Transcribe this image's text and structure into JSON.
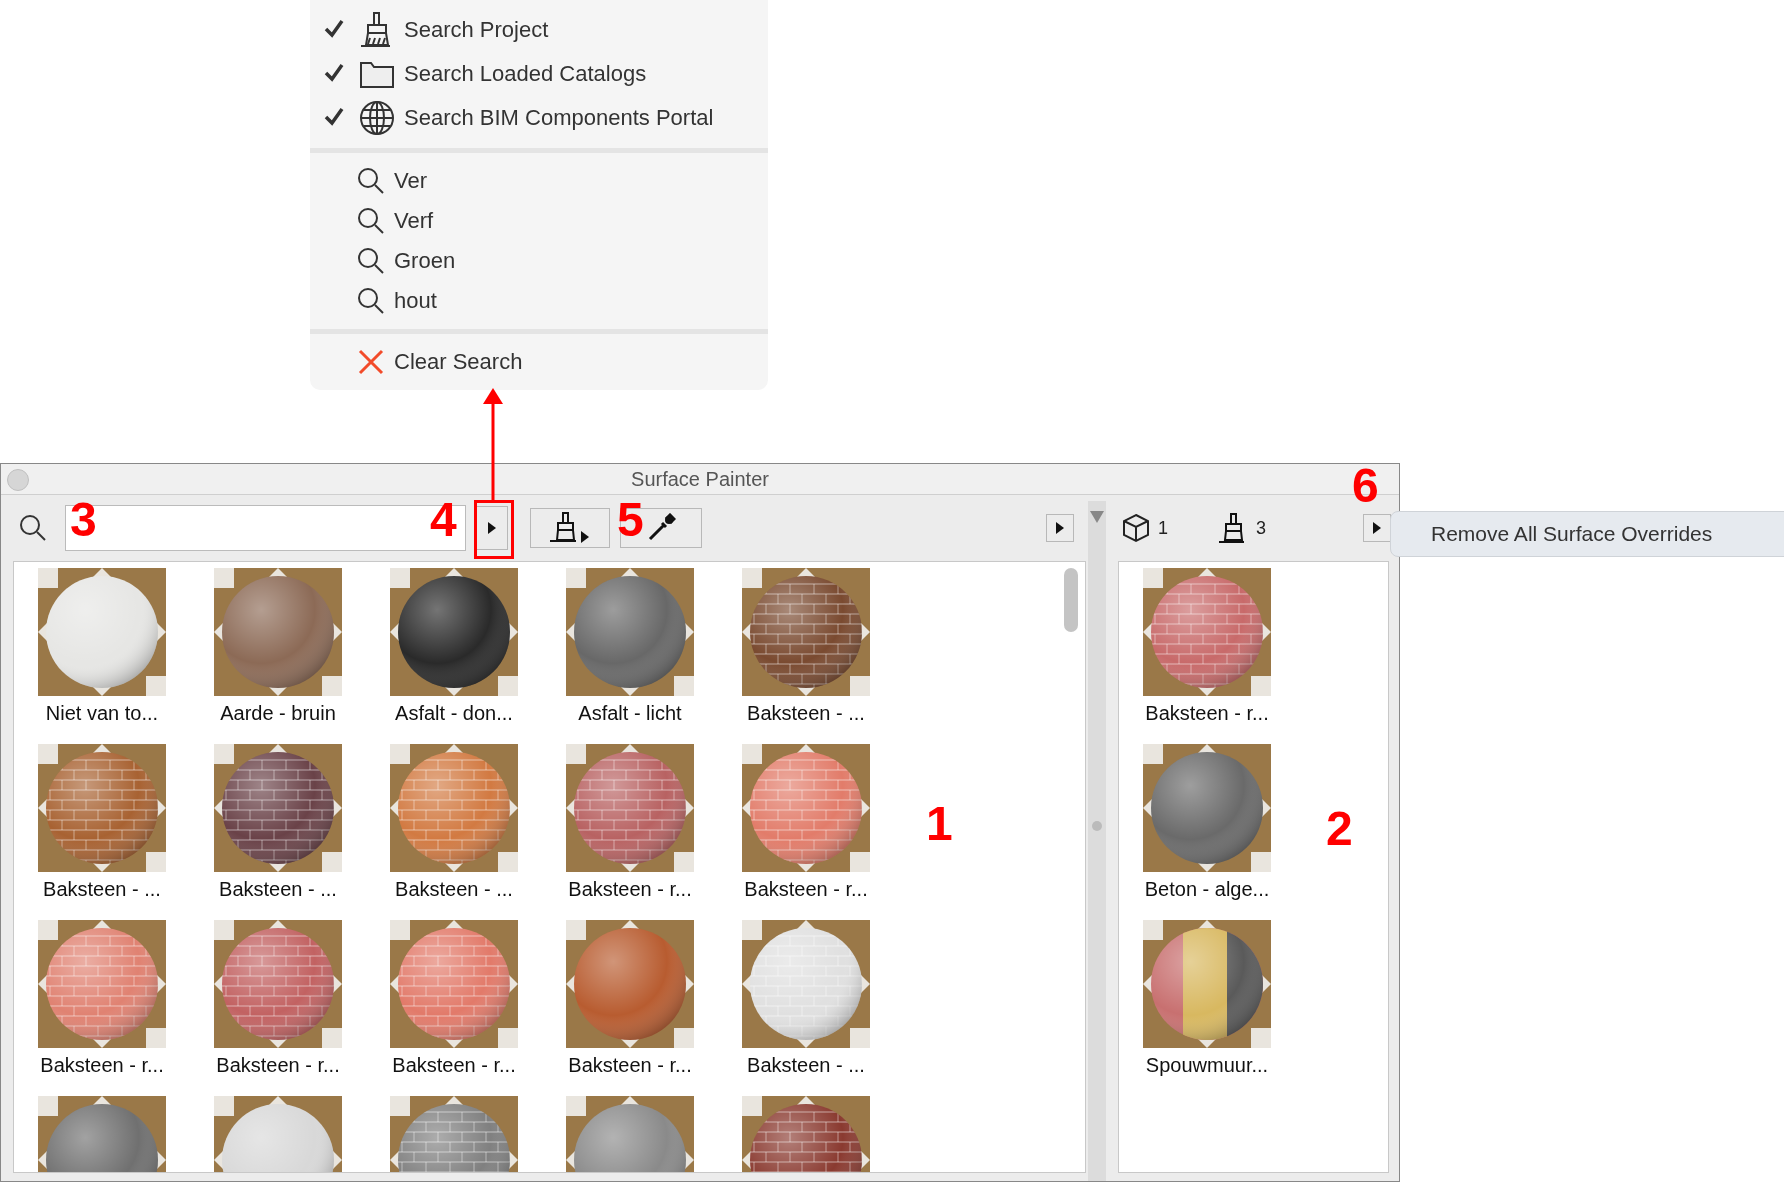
{
  "menu": {
    "sources": [
      {
        "label": "Search Project",
        "checked": true
      },
      {
        "label": "Search Loaded Catalogs",
        "checked": true
      },
      {
        "label": "Search BIM Components Portal",
        "checked": true
      }
    ],
    "recent": [
      {
        "label": "Ver"
      },
      {
        "label": "Verf"
      },
      {
        "label": "Groen"
      },
      {
        "label": "hout"
      }
    ],
    "clear": {
      "label": "Clear Search"
    }
  },
  "window": {
    "title": "Surface Painter"
  },
  "materials": [
    {
      "name": "Niet van to...",
      "color": "#e6e6e4",
      "kind": "plain"
    },
    {
      "name": "Aarde - bruin",
      "color": "#8c6a56",
      "kind": "plain"
    },
    {
      "name": "Asfalt - don...",
      "color": "#2a2a2a",
      "kind": "plain"
    },
    {
      "name": "Asfalt - licht",
      "color": "#686868",
      "kind": "plain"
    },
    {
      "name": "Baksteen - ...",
      "color": "#7a4a30",
      "kind": "brick"
    },
    {
      "name": "Baksteen - ...",
      "color": "#a86232",
      "kind": "brick"
    },
    {
      "name": "Baksteen - ...",
      "color": "#6a4248",
      "kind": "brick"
    },
    {
      "name": "Baksteen - ...",
      "color": "#d27a42",
      "kind": "brick"
    },
    {
      "name": "Baksteen - r...",
      "color": "#b86262",
      "kind": "brick"
    },
    {
      "name": "Baksteen - r...",
      "color": "#e27c6a",
      "kind": "brick"
    },
    {
      "name": "Baksteen - r...",
      "color": "#e08272",
      "kind": "brick"
    },
    {
      "name": "Baksteen - r...",
      "color": "#c26262",
      "kind": "brick"
    },
    {
      "name": "Baksteen - r...",
      "color": "#e27a6a",
      "kind": "brick"
    },
    {
      "name": "Baksteen - r...",
      "color": "#b85c30",
      "kind": "plain"
    },
    {
      "name": "Baksteen - ...",
      "color": "#e0e0e0",
      "kind": "brick"
    },
    {
      "color": "#707070",
      "kind": "plain"
    },
    {
      "color": "#d8d8d8",
      "kind": "plain"
    },
    {
      "color": "#808080",
      "kind": "brick"
    },
    {
      "color": "#8a8a8a",
      "kind": "plain"
    },
    {
      "color": "#8a3a30",
      "kind": "brick"
    }
  ],
  "used": {
    "counts": [
      {
        "value": "1"
      },
      {
        "value": "3"
      }
    ],
    "items": [
      {
        "name": "Baksteen - r...",
        "color": "#c86a6a",
        "kind": "brick"
      },
      {
        "name": "Beton - alge...",
        "color": "#6a6a6a",
        "kind": "plain"
      },
      {
        "name": "Spouwmuur...",
        "color": "#c87070",
        "kind": "split"
      }
    ]
  },
  "popup": {
    "label": "Remove All Surface Overrides"
  },
  "annotations": [
    {
      "label": "3"
    },
    {
      "label": "4"
    },
    {
      "label": "5"
    },
    {
      "label": "6"
    },
    {
      "label": "1"
    },
    {
      "label": "2"
    }
  ]
}
